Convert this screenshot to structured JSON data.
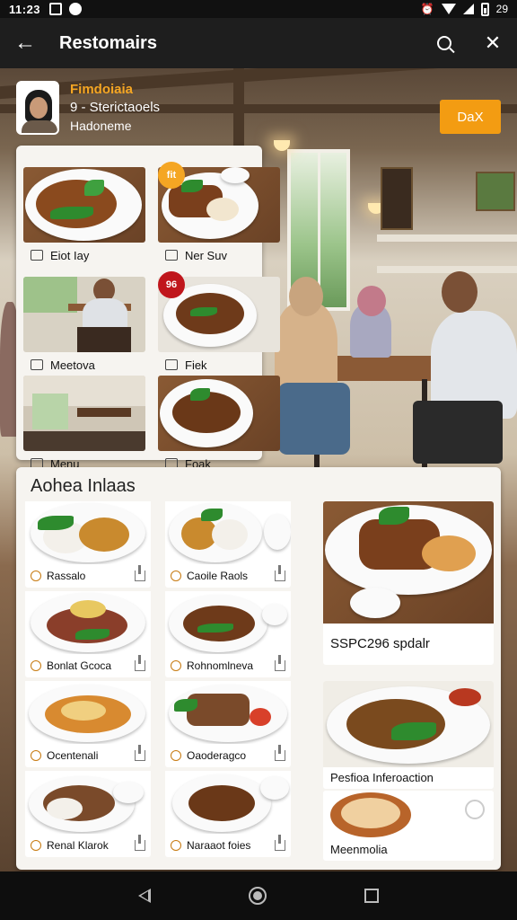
{
  "status_bar": {
    "time": "11:23",
    "battery": "29"
  },
  "app_bar": {
    "title": "Restomairs"
  },
  "profile": {
    "name": "Fimdoiaia",
    "line1": "9 - Sterictaoels",
    "line2": "Hadoneme",
    "button": "DaX"
  },
  "top_card": {
    "items": [
      {
        "label": "Eiot Iay",
        "badge": ""
      },
      {
        "label": "Ner Suv",
        "badge": "fit"
      },
      {
        "label": "Meetova",
        "badge": ""
      },
      {
        "label": "Fiek",
        "badge": "96"
      },
      {
        "label": "Menu",
        "badge": ""
      },
      {
        "label": "Foak",
        "badge": ""
      }
    ]
  },
  "bottom_card": {
    "title": "Aohea Inlaas",
    "grid": [
      {
        "label": "Rassalo"
      },
      {
        "label": "Caoile Raols"
      },
      {
        "label": "Bonlat Gcoca"
      },
      {
        "label": "Rohnomlneva"
      },
      {
        "label": "Ocentenali"
      },
      {
        "label": "Oaoderagco"
      },
      {
        "label": "Renal Klarok"
      },
      {
        "label": "Naraaot foies"
      }
    ],
    "featured": [
      {
        "label": "SSPC296 spdalr"
      },
      {
        "label": "Pesfioa Inferoaction"
      },
      {
        "label": "Meenmolia"
      }
    ]
  },
  "colors": {
    "accent": "#f39c12",
    "bar": "#1e1e1e"
  },
  "icons": {
    "back": "arrow-left-icon",
    "search": "search-icon",
    "close": "close-icon"
  }
}
